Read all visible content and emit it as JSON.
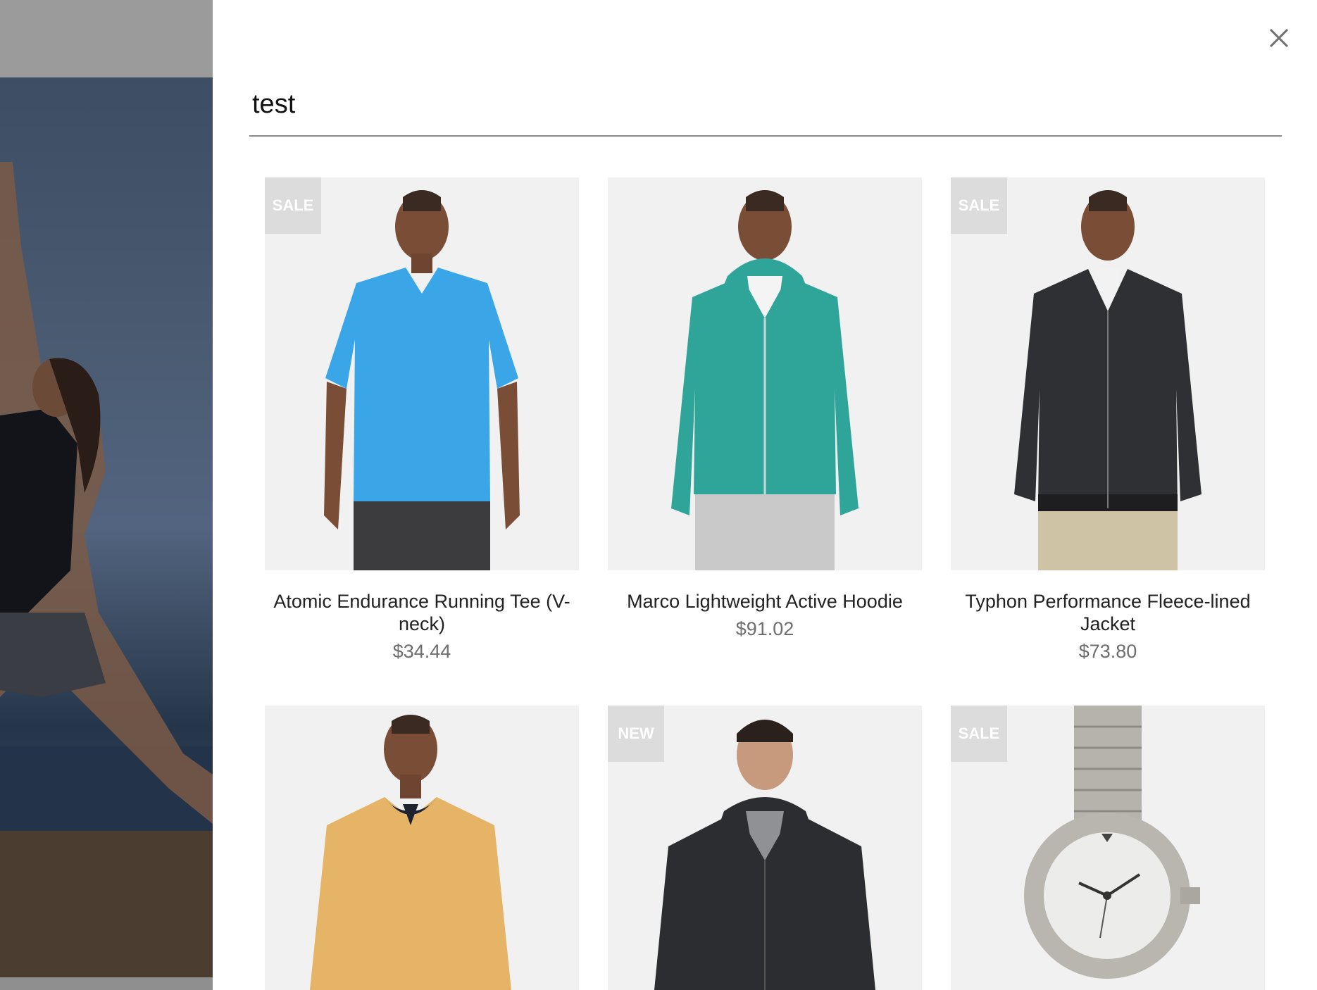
{
  "search": {
    "query": "test",
    "close_icon": "close-icon"
  },
  "products": [
    {
      "name": "Atomic Endurance Running Tee (V-neck)",
      "price": "$34.44",
      "badge": "SALE",
      "image": "blue-v-neck-tee"
    },
    {
      "name": "Marco Lightweight Active Hoodie",
      "price": "$91.02",
      "badge": "",
      "image": "teal-zip-hoodie"
    },
    {
      "name": "Typhon Performance Fleece-lined Jacket",
      "price": "$73.80",
      "badge": "SALE",
      "image": "black-bomber-jacket"
    },
    {
      "name": "",
      "price": "",
      "badge": "",
      "image": "mustard-sweatshirt"
    },
    {
      "name": "",
      "price": "",
      "badge": "NEW",
      "image": "black-zip-hoodie"
    },
    {
      "name": "",
      "price": "",
      "badge": "SALE",
      "image": "silver-wristwatch"
    }
  ],
  "colors": {
    "badge_bg": "#dcdcdc",
    "card_bg": "#f1f1f1",
    "price_text": "#6e6e6e",
    "overlay_header": "#9b9b9b"
  }
}
